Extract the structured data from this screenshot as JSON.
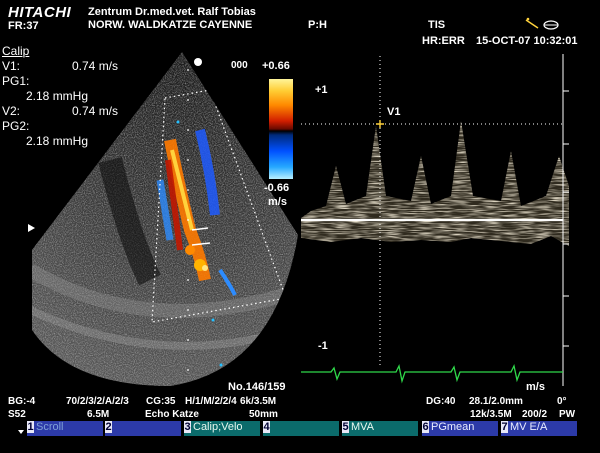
{
  "header": {
    "logo": "HITACHI",
    "frame_rate": "FR:37",
    "clinic": "Zentrum Dr.med.vet. Ralf Tobias",
    "patient": "NORW. WALDKATZE  CAYENNE",
    "probe_side": "P:H",
    "tis": "TIS",
    "hr": "HR:ERR",
    "datetime": "15-OCT-07 10:32:01"
  },
  "calip": {
    "title": "Calip",
    "v1_label": "V1:",
    "v1_value": "0.74 m/s",
    "pg1_label": "PG1:",
    "pg1_value": "2.18 mmHg",
    "v2_label": "V2:",
    "v2_value": "0.74 m/s",
    "pg2_label": "PG2:",
    "pg2_value": "2.18 mmHg"
  },
  "colorbar": {
    "max": "+0.66",
    "min": "-0.66",
    "unit": "m/s",
    "gain_label": "000"
  },
  "doppler": {
    "scale_top": "+1",
    "scale_bottom": "-1",
    "cursor_label": "V1",
    "unit": "m/s"
  },
  "image_number": "No.146/159",
  "params": {
    "bg": "BG:-4",
    "preset": "70/2/3/2/A/2/3",
    "cg": "CG:35",
    "h": "H/1/M/2/2/4",
    "freq": "6k/3.5M",
    "s": "S52",
    "probe_freq": "6.5M",
    "exam": "Echo Katze",
    "depth": "50mm",
    "dg": "DG:40",
    "gate": "28.1/2.0mm",
    "angle": "0°",
    "prf": "12k/3.5M",
    "filter": "200/2",
    "mode": "PW"
  },
  "function_keys": [
    {
      "num": "1",
      "label": "Scroll"
    },
    {
      "num": "2",
      "label": ""
    },
    {
      "num": "3",
      "label": "Calip;Velo"
    },
    {
      "num": "4",
      "label": ""
    },
    {
      "num": "5",
      "label": "MVA"
    },
    {
      "num": "6",
      "label": "PGmean"
    },
    {
      "num": "7",
      "label": "MV E/A"
    }
  ],
  "colors": {
    "accent_yellow": "#ffd23c",
    "ecg_green": "#2fd84a",
    "fkey_blue": "#2c3aa8",
    "fkey_teal": "#0b6b6b"
  }
}
